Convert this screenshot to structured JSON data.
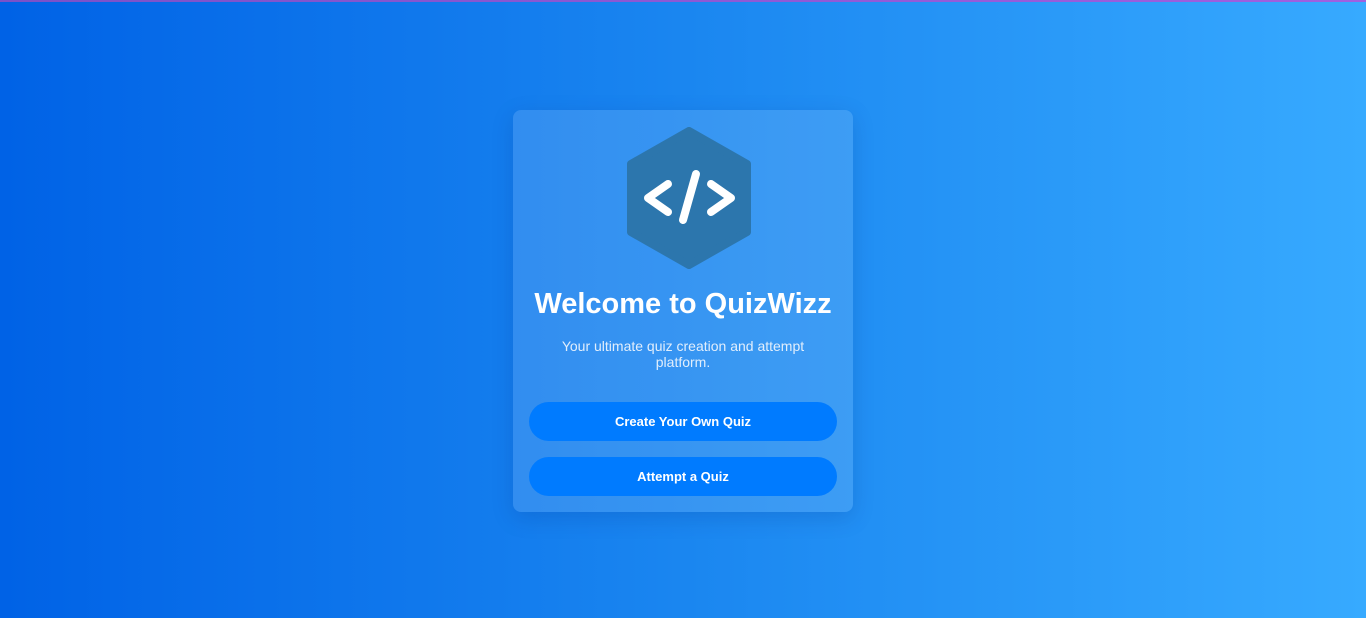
{
  "welcome": {
    "logo_icon": "code-brackets-icon",
    "title": "Welcome to QuizWizz",
    "subtitle": "Your ultimate quiz creation and attempt platform.",
    "create_quiz_label": "Create Your Own Quiz",
    "attempt_quiz_label": "Attempt a Quiz"
  },
  "colors": {
    "background_start": "#0062e6",
    "background_end": "#37aaff",
    "logo_hexagon": "#2c76ad",
    "button": "#007bff",
    "text": "#ffffff"
  }
}
